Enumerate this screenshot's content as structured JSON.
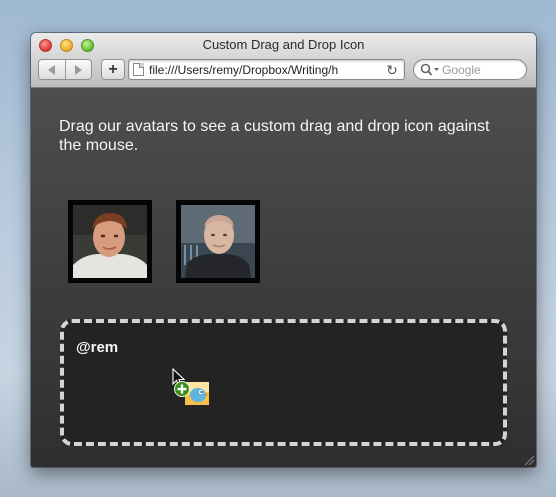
{
  "window": {
    "title": "Custom Drag and Drop Icon"
  },
  "toolbar": {
    "back_icon": "back-arrow-icon",
    "forward_icon": "forward-arrow-icon",
    "add_label": "+",
    "url": "file:///Users/remy/Dropbox/Writing/h",
    "reload_icon": "reload-icon",
    "search_placeholder": "Google"
  },
  "page": {
    "instructions": "Drag our avatars to see a custom drag and drop icon against the mouse.",
    "avatars": [
      {
        "name": "avatar-1"
      },
      {
        "name": "avatar-2"
      }
    ],
    "drop_zone": {
      "label": "@rem"
    }
  },
  "colors": {
    "page_background": "#3f3f3f",
    "drop_zone_background": "#232323",
    "drop_zone_border": "#d4d4d4",
    "text": "#f5f5f5"
  }
}
